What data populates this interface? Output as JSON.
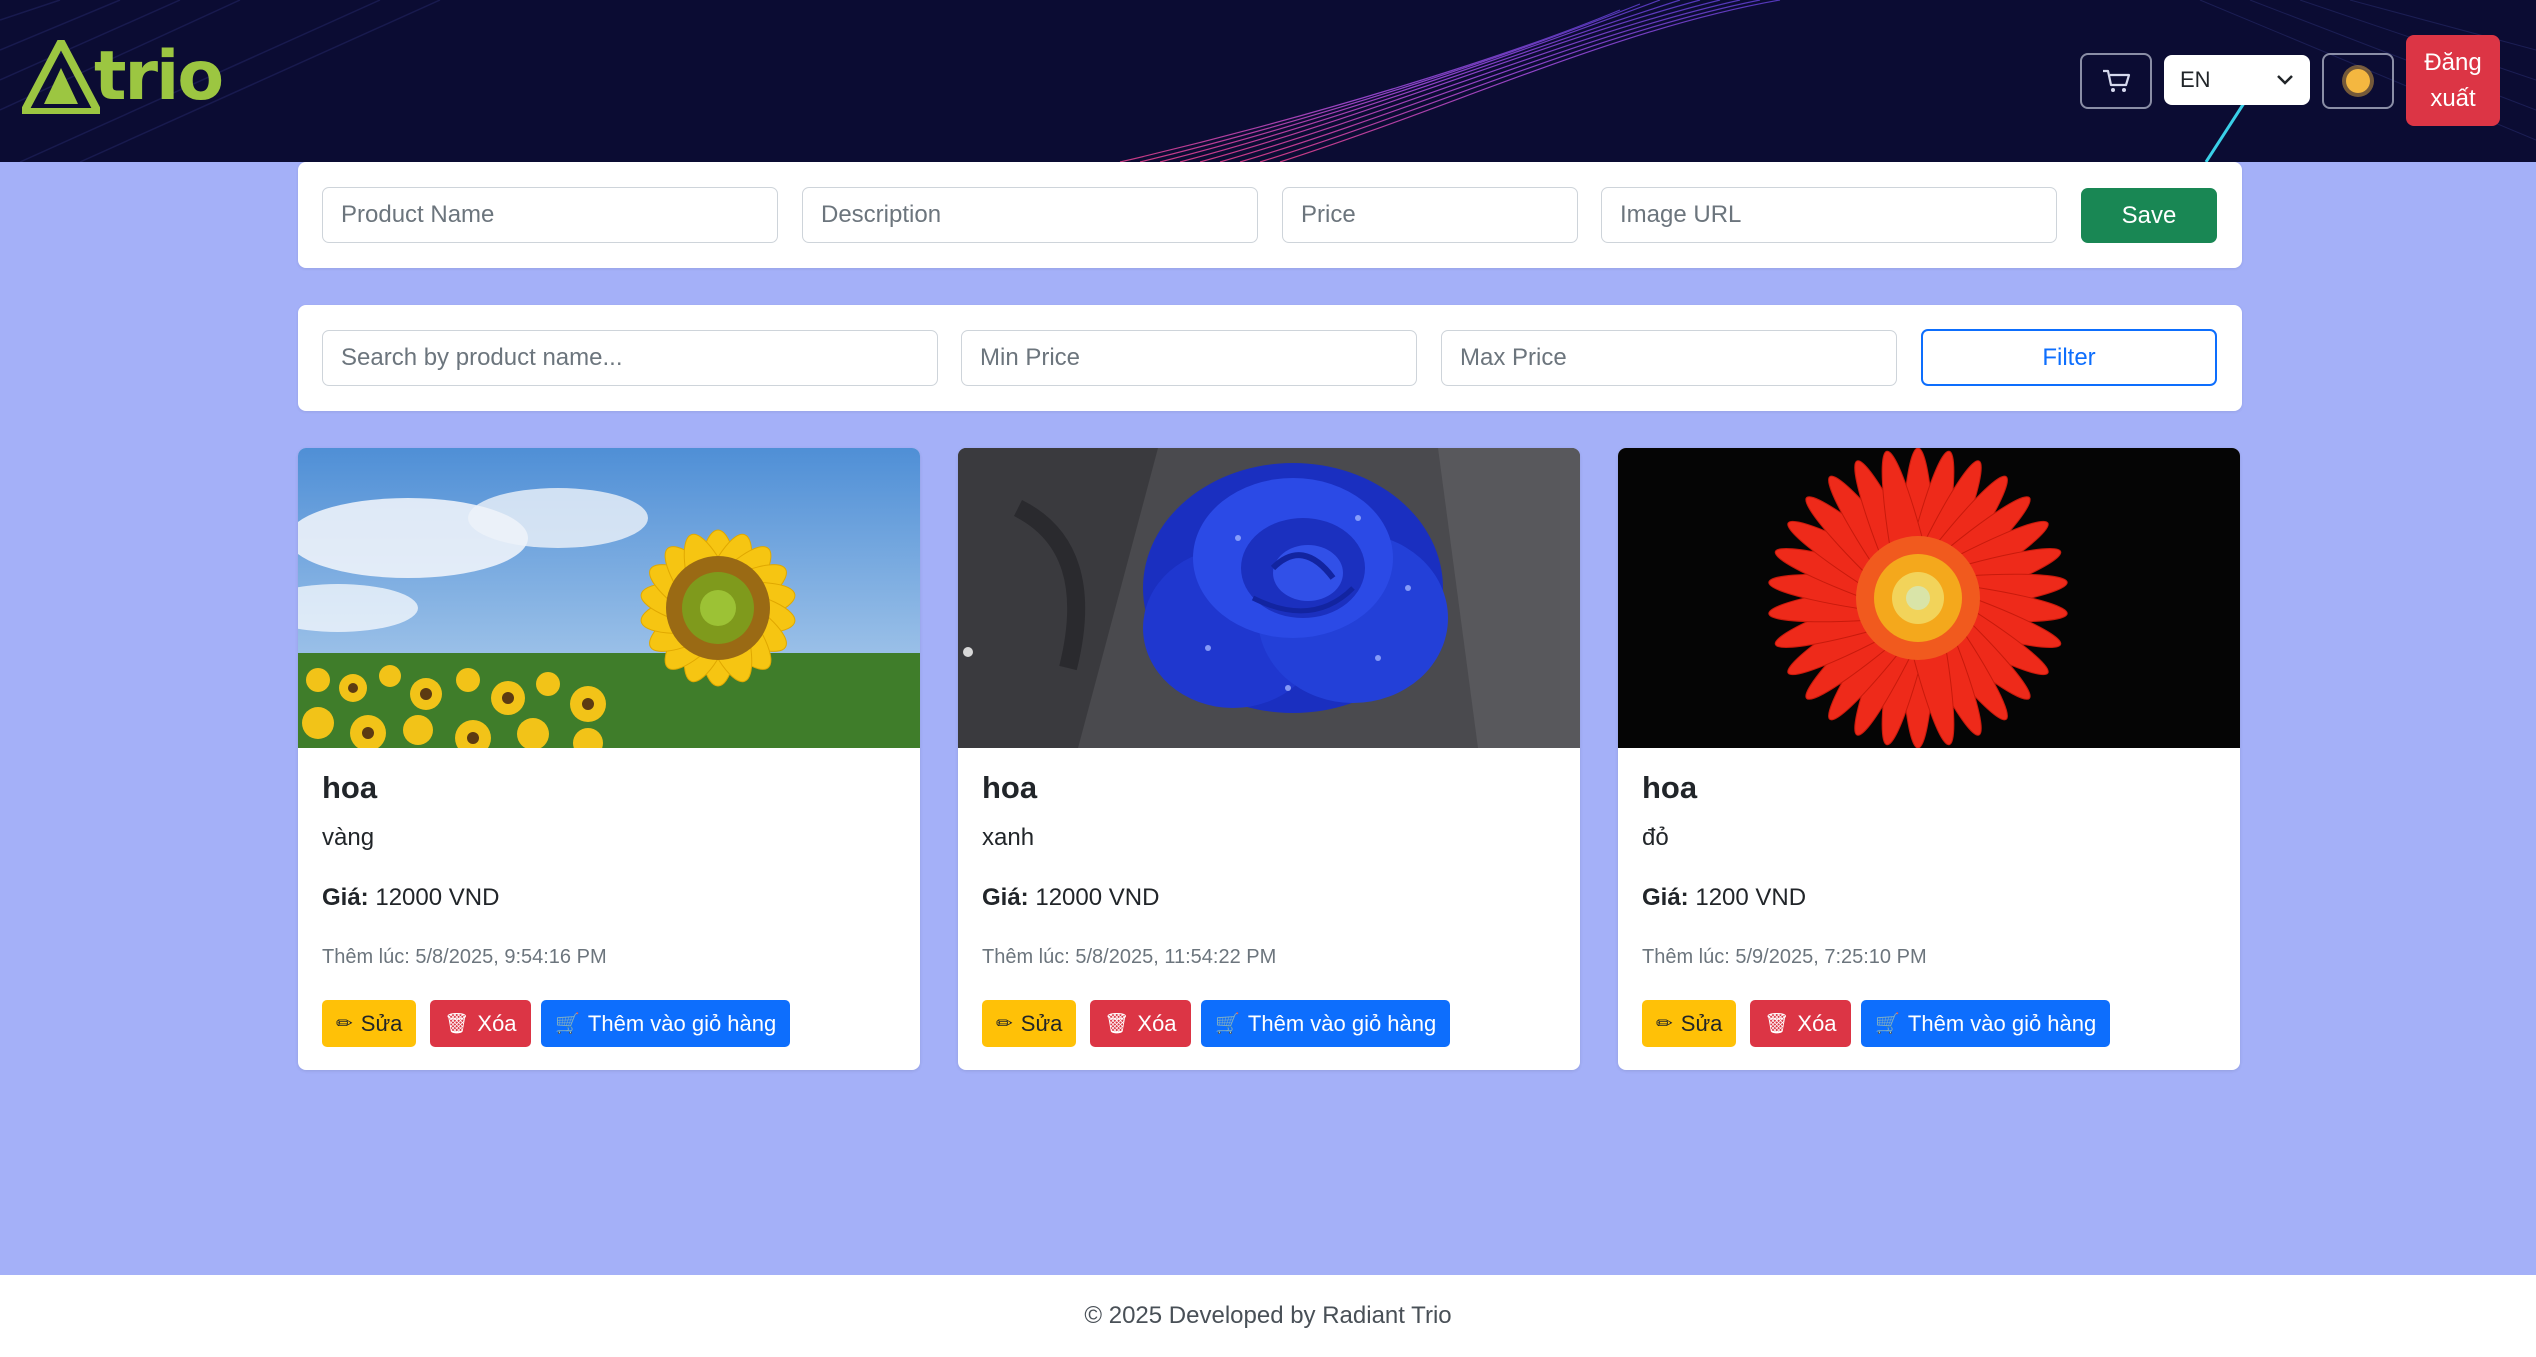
{
  "header": {
    "logo_text": "trio",
    "cart_icon": "cart-icon",
    "language": {
      "selected": "EN",
      "options": [
        "EN"
      ]
    },
    "theme_icon": "sun-icon",
    "logout_label": "Đăng xuất"
  },
  "product_form": {
    "name_placeholder": "Product Name",
    "description_placeholder": "Description",
    "price_placeholder": "Price",
    "image_url_placeholder": "Image URL",
    "save_label": "Save"
  },
  "filter_form": {
    "search_placeholder": "Search by product name...",
    "min_price_placeholder": "Min Price",
    "max_price_placeholder": "Max Price",
    "filter_label": "Filter"
  },
  "labels": {
    "price_prefix": "Giá:",
    "edit": "Sửa",
    "delete": "Xóa",
    "add_to_cart": "Thêm vào giỏ hàng"
  },
  "products": [
    {
      "name": "hoa",
      "description": "vàng",
      "price": "12000 VND",
      "added": "Thêm lúc: 5/8/2025, 9:54:16 PM",
      "image": "sunflower"
    },
    {
      "name": "hoa",
      "description": "xanh",
      "price": "12000 VND",
      "added": "Thêm lúc: 5/8/2025, 11:54:22 PM",
      "image": "blue-rose"
    },
    {
      "name": "hoa",
      "description": "đỏ",
      "price": "1200 VND",
      "added": "Thêm lúc: 5/9/2025, 7:25:10 PM",
      "image": "red-gerbera"
    }
  ],
  "colors": {
    "header_bg": "#0b0c33",
    "page_bg": "#a4b0f8",
    "logo": "#9cc641",
    "success": "#198754",
    "primary": "#0d6efd",
    "danger": "#dc3545",
    "warning": "#ffc107"
  },
  "footer": {
    "text": "© 2025 Developed by Radiant Trio"
  }
}
